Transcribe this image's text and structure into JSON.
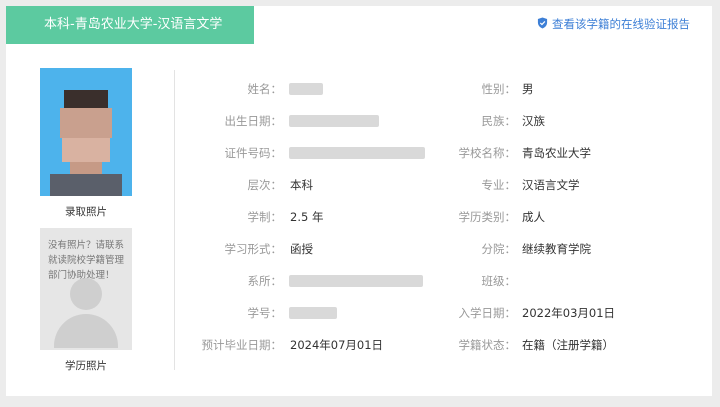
{
  "header": {
    "title": "本科-青岛农业大学-汉语言文学",
    "verify_link": "查看该学籍的在线验证报告"
  },
  "photos": {
    "enrollment_label": "录取照片",
    "diploma_label": "学历照片",
    "no_photo_text": "没有照片？请联系就读院校学籍管理部门协助处理！"
  },
  "left_fields": [
    {
      "label": "姓名：",
      "value": ""
    },
    {
      "label": "出生日期：",
      "value": ""
    },
    {
      "label": "证件号码：",
      "value": ""
    },
    {
      "label": "层次：",
      "value": "本科"
    },
    {
      "label": "学制：",
      "value": "2.5 年"
    },
    {
      "label": "学习形式：",
      "value": "函授"
    },
    {
      "label": "系所：",
      "value": ""
    },
    {
      "label": "学号：",
      "value": ""
    },
    {
      "label": "预计毕业日期：",
      "value": "2024年07月01日"
    }
  ],
  "right_fields": [
    {
      "label": "性别：",
      "value": "男"
    },
    {
      "label": "民族：",
      "value": "汉族"
    },
    {
      "label": "学校名称：",
      "value": "青岛农业大学"
    },
    {
      "label": "专业：",
      "value": "汉语言文学"
    },
    {
      "label": "学历类别：",
      "value": "成人"
    },
    {
      "label": "分院：",
      "value": "继续教育学院"
    },
    {
      "label": "班级：",
      "value": ""
    },
    {
      "label": "入学日期：",
      "value": "2022年03月01日"
    },
    {
      "label": "学籍状态：",
      "value": "在籍（注册学籍）"
    }
  ],
  "colors": {
    "header_bg": "#5ccaa0",
    "link": "#3d7fd6"
  },
  "icons": {
    "verify": "shield-check-icon"
  }
}
